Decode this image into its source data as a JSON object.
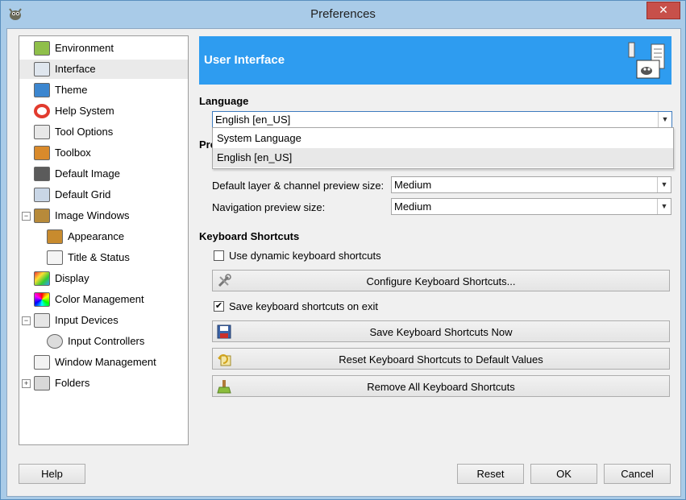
{
  "window": {
    "title": "Preferences",
    "close_glyph": "✕"
  },
  "sidebar": {
    "items": [
      {
        "label": "Environment",
        "icon": "environment-icon"
      },
      {
        "label": "Interface",
        "icon": "interface-icon"
      },
      {
        "label": "Theme",
        "icon": "theme-icon"
      },
      {
        "label": "Help System",
        "icon": "help-system-icon"
      },
      {
        "label": "Tool Options",
        "icon": "tool-options-icon"
      },
      {
        "label": "Toolbox",
        "icon": "toolbox-icon"
      },
      {
        "label": "Default Image",
        "icon": "default-image-icon"
      },
      {
        "label": "Default Grid",
        "icon": "default-grid-icon"
      },
      {
        "label": "Image Windows",
        "icon": "image-windows-icon",
        "expander": "−"
      },
      {
        "label": "Appearance",
        "icon": "appearance-icon"
      },
      {
        "label": "Title & Status",
        "icon": "title-status-icon"
      },
      {
        "label": "Display",
        "icon": "display-icon"
      },
      {
        "label": "Color Management",
        "icon": "color-management-icon"
      },
      {
        "label": "Input Devices",
        "icon": "input-devices-icon",
        "expander": "−"
      },
      {
        "label": "Input Controllers",
        "icon": "input-controllers-icon"
      },
      {
        "label": "Window Management",
        "icon": "window-management-icon"
      },
      {
        "label": "Folders",
        "icon": "folders-icon",
        "expander": "+"
      }
    ],
    "selected": "Interface"
  },
  "banner": {
    "title": "User Interface",
    "icon": "gimp-interface-icon"
  },
  "language": {
    "section": "Language",
    "value": "English [en_US]",
    "options": [
      "System Language",
      "English [en_US]"
    ],
    "highlighted": "English [en_US]"
  },
  "previews": {
    "section_partial": "Pre",
    "layer_label": "Default layer & channel preview size:",
    "layer_value": "Medium",
    "nav_label": "Navigation preview size:",
    "nav_value": "Medium"
  },
  "shortcuts": {
    "section": "Keyboard Shortcuts",
    "dynamic_label": "Use dynamic keyboard shortcuts",
    "dynamic_checked": false,
    "configure_label": "Configure Keyboard Shortcuts...",
    "save_on_exit_label": "Save keyboard shortcuts on exit",
    "save_on_exit_checked": true,
    "save_now_label": "Save Keyboard Shortcuts Now",
    "reset_label": "Reset Keyboard Shortcuts to Default Values",
    "remove_label": "Remove All Keyboard Shortcuts"
  },
  "footer": {
    "help": "Help",
    "reset": "Reset",
    "ok": "OK",
    "cancel": "Cancel"
  },
  "colors": {
    "accent": "#2e9cf0",
    "titlebar": "#a9cbe8",
    "close": "#c7504a"
  }
}
